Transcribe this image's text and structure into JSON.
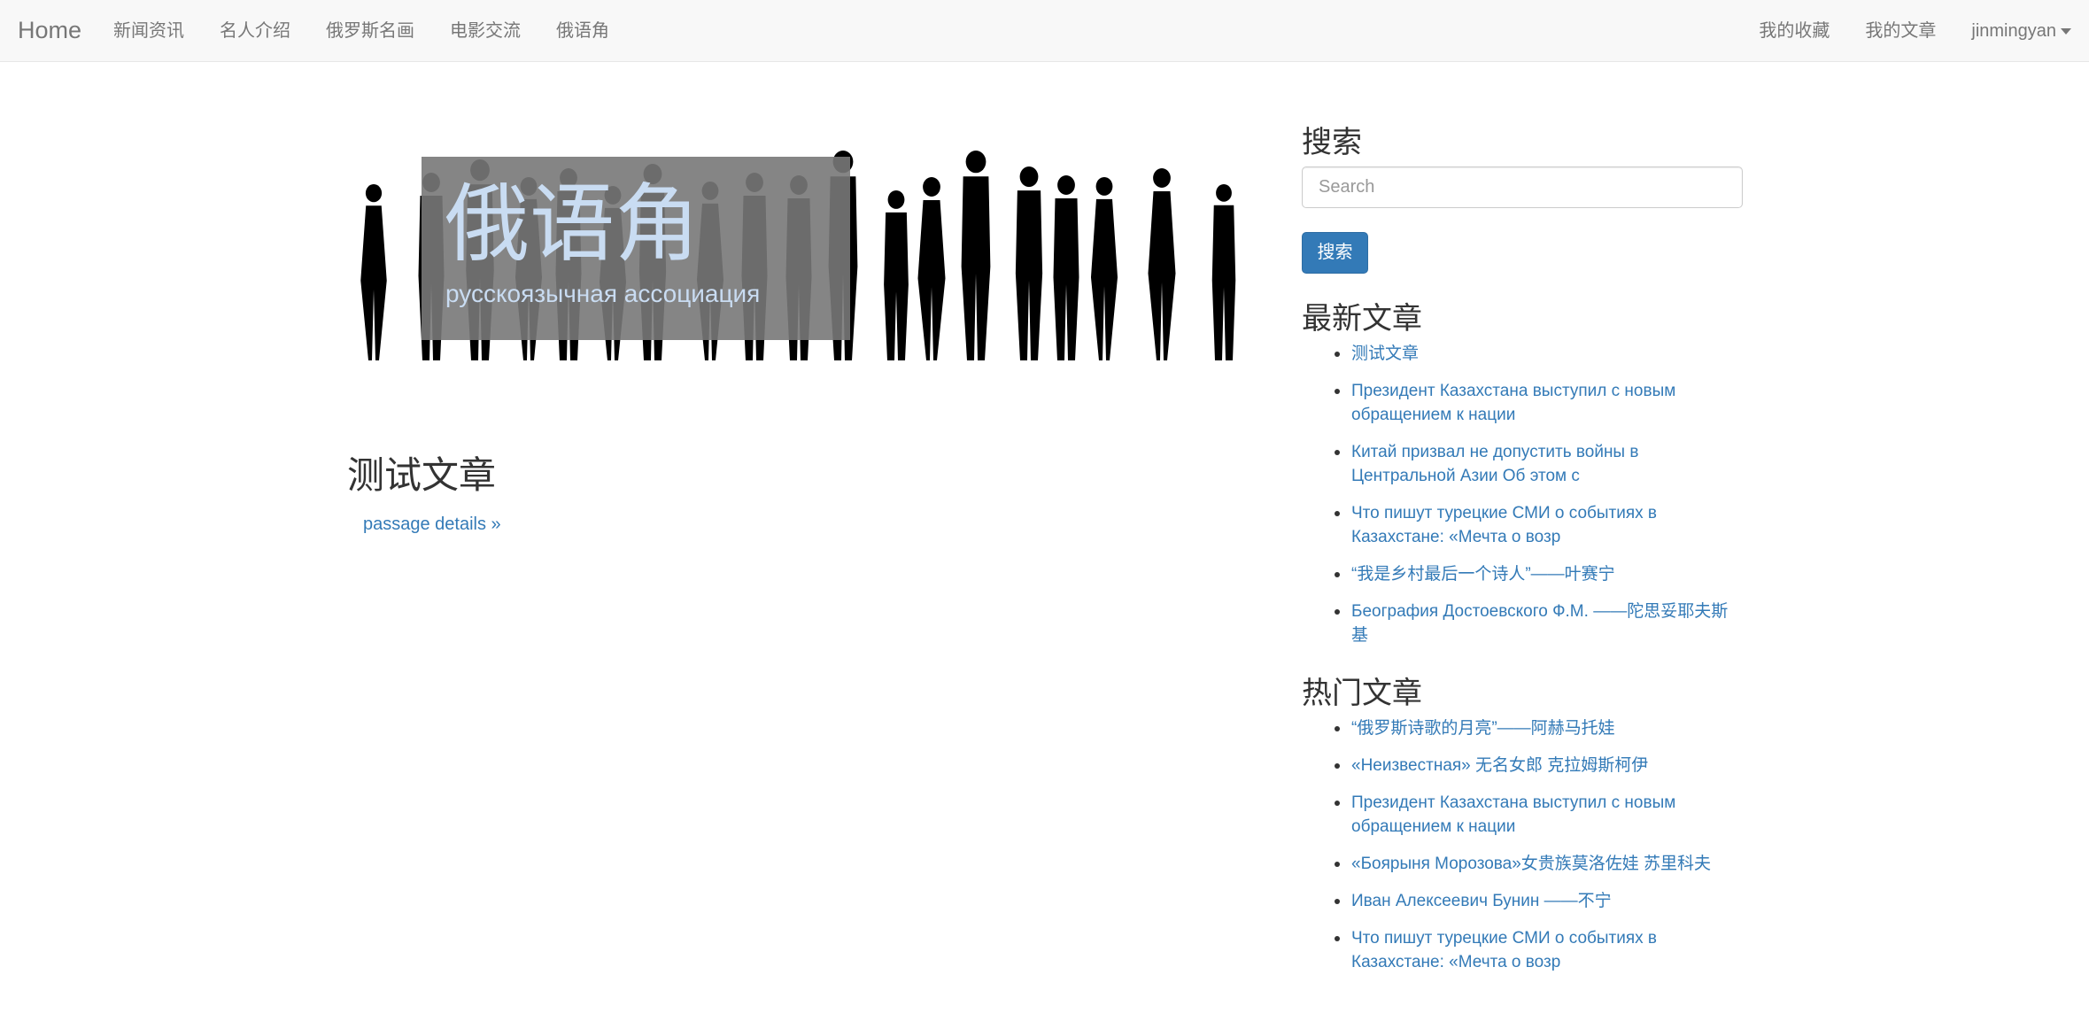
{
  "navbar": {
    "brand": "Home",
    "left_items": [
      "新闻资讯",
      "名人介绍",
      "俄罗斯名画",
      "电影交流",
      "俄语角"
    ],
    "right_items": [
      "我的收藏",
      "我的文章"
    ],
    "user": "jinmingyan"
  },
  "hero": {
    "title": "俄语角",
    "subtitle": "русскоязычная ассоциация"
  },
  "article": {
    "title": "测试文章",
    "link": "passage details »"
  },
  "sidebar": {
    "search_heading": "搜索",
    "search_placeholder": "Search",
    "search_button": "搜索",
    "latest_heading": "最新文章",
    "latest": [
      "测试文章",
      "Президент Казахстана выступил с новым обращением к нации",
      "Китай призвал не допустить войны в Центральной Азии Об этом с",
      "Что пишут турецкие СМИ о событиях в Казахстане: «Мечта о возр",
      "“我是乡村最后一个诗人”——叶赛宁",
      "Беография Достоевского Ф.М. ——陀思妥耶夫斯基"
    ],
    "hot_heading": "热门文章",
    "hot": [
      "“俄罗斯诗歌的月亮”——阿赫马托娃",
      "«Неизвестная» 无名女郎 克拉姆斯柯伊",
      "Президент Казахстана выступил с новым обращением к нации",
      "«Боярыня Морозова»女贵族莫洛佐娃 苏里科夫",
      "Иван Алексеевич Бунин ——不宁",
      "Что пишут турецкие СМИ о событиях в Казахстане: «Мечта о возр"
    ]
  },
  "colors": {
    "link": "#337ab7",
    "navbar_bg": "#f8f8f8",
    "hero_text": "#c9dcf2"
  }
}
